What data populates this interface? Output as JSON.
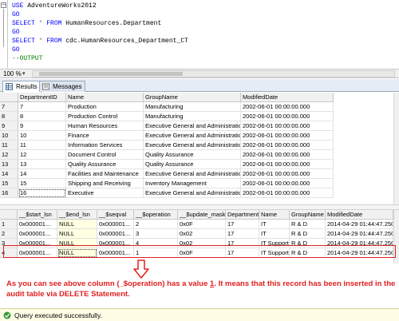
{
  "editor": {
    "collapse_symbol": "−",
    "lines": [
      {
        "kw": "USE",
        "rest": " AdventureWorks2012"
      },
      {
        "kw": "GO",
        "rest": ""
      },
      {
        "kw": "SELECT",
        "star": " * ",
        "kw2": "FROM",
        "rest": " HumanResources.Department"
      },
      {
        "kw": "GO",
        "rest": ""
      },
      {
        "kw": "SELECT",
        "star": " * ",
        "kw2": "FROM",
        "rest": " cdc.HumanResources_Department_CT"
      },
      {
        "kw": "GO",
        "rest": ""
      },
      {
        "comment": "--OUTPUT"
      }
    ]
  },
  "zoom": {
    "value": "100 %",
    "arrow": "▾"
  },
  "tabs": {
    "results": "Results",
    "messages": "Messages"
  },
  "grid1": {
    "headers": [
      "",
      "DepartmentID",
      "Name",
      "GroupName",
      "ModifiedDate"
    ],
    "rows": [
      [
        "7",
        "7",
        "Production",
        "Manufacturing",
        "2002-06-01 00:00:00.000"
      ],
      [
        "8",
        "8",
        "Production Control",
        "Manufacturing",
        "2002-06-01 00:00:00.000"
      ],
      [
        "9",
        "9",
        "Human Resources",
        "Executive General and Administration",
        "2002-06-01 00:00:00.000"
      ],
      [
        "10",
        "10",
        "Finance",
        "Executive General and Administration",
        "2002-06-01 00:00:00.000"
      ],
      [
        "11",
        "11",
        "Information Services",
        "Executive General and Administration",
        "2002-06-01 00:00:00.000"
      ],
      [
        "12",
        "12",
        "Document Control",
        "Quality Assurance",
        "2002-06-01 00:00:00.000"
      ],
      [
        "13",
        "13",
        "Quality Assurance",
        "Quality Assurance",
        "2002-06-01 00:00:00.000"
      ],
      [
        "14",
        "14",
        "Facilities and Maintenance",
        "Executive General and Administration",
        "2002-06-01 00:00:00.000"
      ],
      [
        "15",
        "15",
        "Shipping and Receiving",
        "Inventory Management",
        "2002-06-01 00:00:00.000"
      ],
      [
        "16",
        "16",
        "Executive",
        "Executive General and Administration",
        "2002-06-01 00:00:00.000"
      ]
    ]
  },
  "grid2": {
    "headers": [
      "",
      "__$start_lsn",
      "__$end_lsn",
      "__$seqval",
      "__$operation",
      "__$update_mask",
      "DepartmentID",
      "Name",
      "GroupName",
      "ModifiedDate"
    ],
    "rows": [
      [
        "1",
        "0x000001...",
        "NULL",
        "0x000001...",
        "2",
        "0x0F",
        "17",
        "IT",
        "R & D",
        "2014-04-29 01:44:47.250"
      ],
      [
        "2",
        "0x000001...",
        "NULL",
        "0x000001...",
        "3",
        "0x02",
        "17",
        "IT",
        "R & D",
        "2014-04-29 01:44:47.250"
      ],
      [
        "3",
        "0x000001...",
        "NULL",
        "0x000001...",
        "4",
        "0x02",
        "17",
        "IT Support",
        "R & D",
        "2014-04-29 01:44:47.250"
      ],
      [
        "4",
        "0x000001...",
        "NULL",
        "0x000001...",
        "1",
        "0x0F",
        "17",
        "IT Support",
        "R & D",
        "2014-04-29 01:44:47.250"
      ]
    ]
  },
  "annotation": {
    "part1": "As you can see above column (_$operation) has a value ",
    "value": "1",
    "part2": ". It means that this record has been inserted in the audit table via DELETE Statement."
  },
  "status": {
    "text": "Query executed successfully."
  },
  "colors": {
    "highlight": "#e02020",
    "keyword": "#0000ff",
    "comment": "#008000",
    "null_bg": "#ffffe1"
  }
}
